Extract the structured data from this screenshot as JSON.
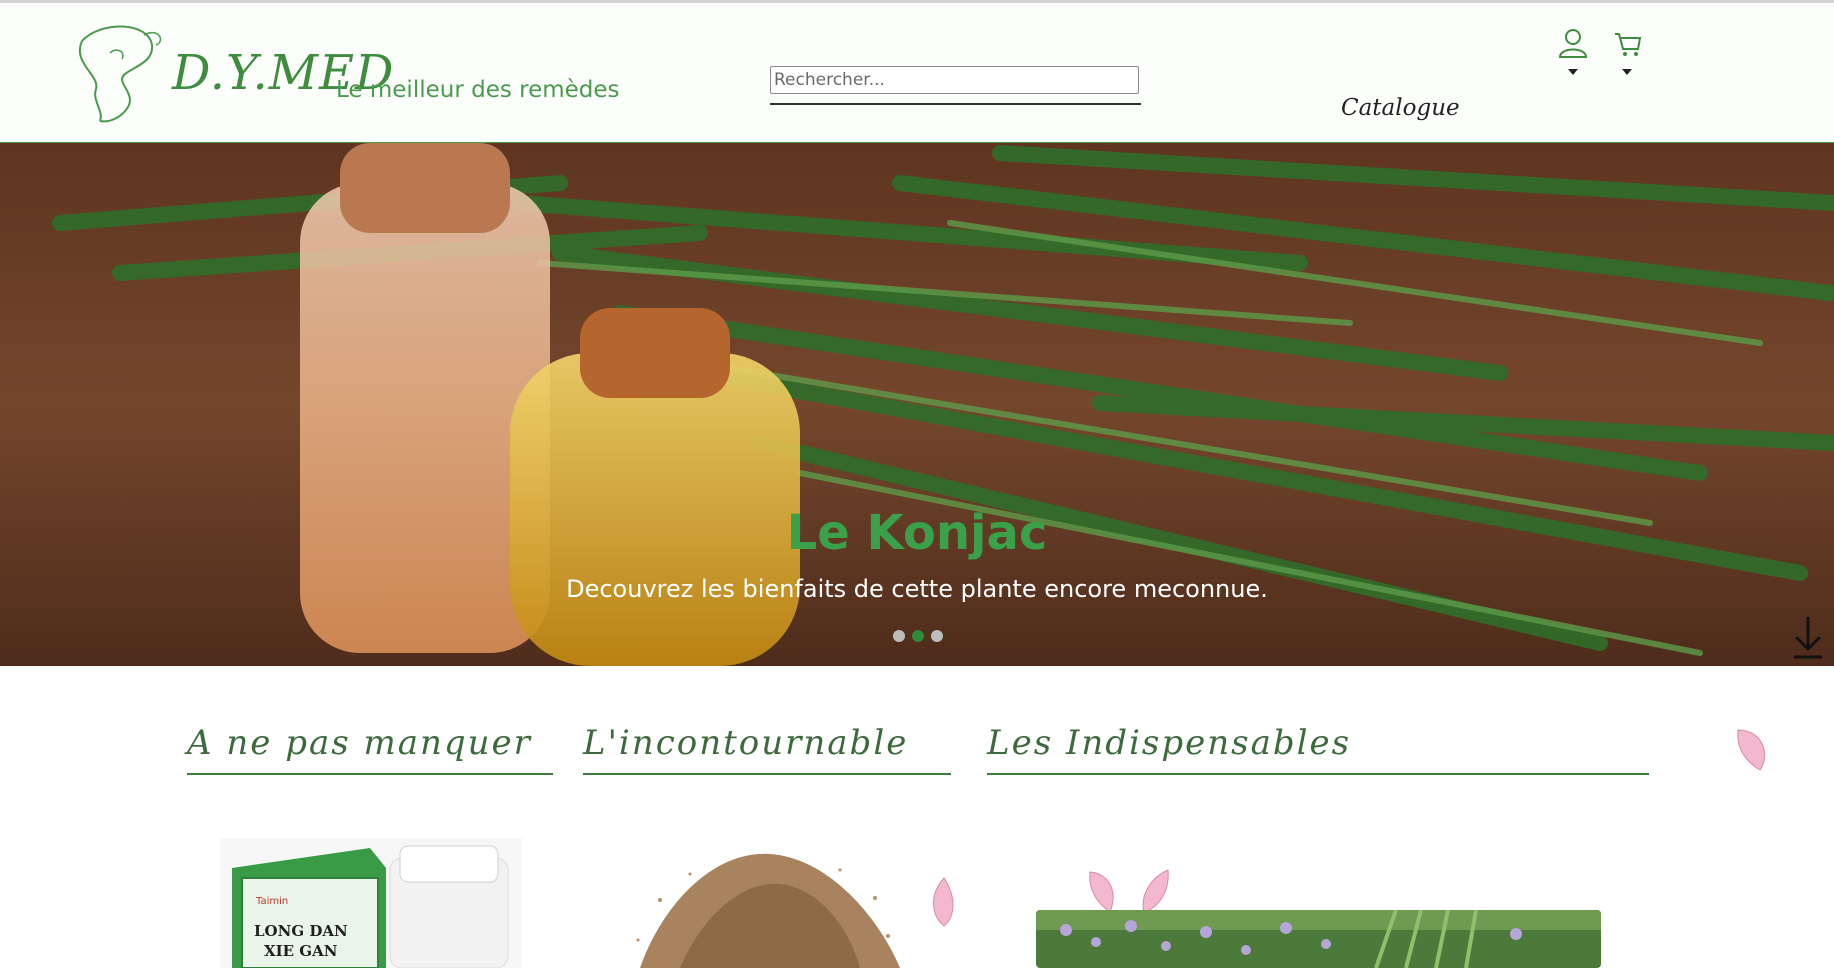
{
  "header": {
    "brand": "D.Y.MED",
    "tagline": "Le meilleur des remèdes",
    "search_placeholder": "Rechercher...",
    "nav_catalogue": "Catalogue",
    "icons": [
      "user-icon",
      "cart-icon"
    ]
  },
  "hero": {
    "title": "Le Konjac",
    "subtitle": "Decouvrez les bienfaits de cette plante encore meconnue.",
    "slides": 3,
    "active_slide": 2
  },
  "sections": [
    {
      "title": "A ne pas manquer"
    },
    {
      "title": "L'incontournable"
    },
    {
      "title": "Les Indispensables"
    }
  ],
  "products": {
    "box_line1": "LONG DAN",
    "box_line2": "XIE GAN",
    "box_brand": "Taimin"
  },
  "colors": {
    "accent": "#3e8d3f",
    "header_bg": "#fcfefb",
    "hero_title": "#3aa04a",
    "active_dot": "#2e8b3a"
  }
}
